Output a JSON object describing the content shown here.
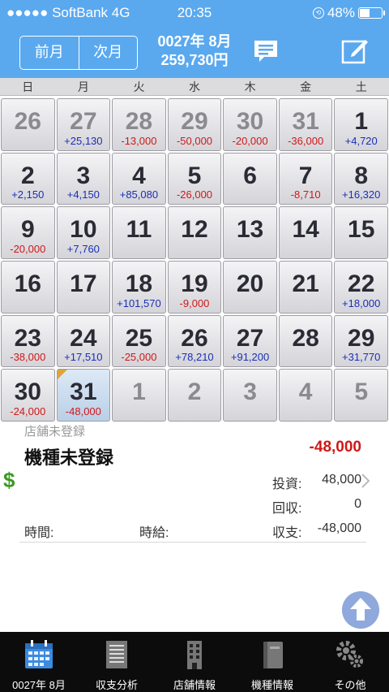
{
  "status": {
    "carrier": "●●●●● SoftBank  4G",
    "time": "20:35",
    "battery": "48%",
    "battery_level": 0.48
  },
  "header": {
    "prev_label": "前月",
    "next_label": "次月",
    "title": "0027年 8月",
    "subtitle": "259,730円"
  },
  "weekdays": [
    "日",
    "月",
    "火",
    "水",
    "木",
    "金",
    "土"
  ],
  "calendar": [
    [
      {
        "d": "26",
        "a": "",
        "g": true
      },
      {
        "d": "27",
        "a": "+25,130",
        "g": true
      },
      {
        "d": "28",
        "a": "-13,000",
        "g": true
      },
      {
        "d": "29",
        "a": "-50,000",
        "g": true
      },
      {
        "d": "30",
        "a": "-20,000",
        "g": true
      },
      {
        "d": "31",
        "a": "-36,000",
        "g": true
      },
      {
        "d": "1",
        "a": "+4,720",
        "g": false
      }
    ],
    [
      {
        "d": "2",
        "a": "+2,150",
        "g": false
      },
      {
        "d": "3",
        "a": "+4,150",
        "g": false
      },
      {
        "d": "4",
        "a": "+85,080",
        "g": false
      },
      {
        "d": "5",
        "a": "-26,000",
        "g": false
      },
      {
        "d": "6",
        "a": "",
        "g": false
      },
      {
        "d": "7",
        "a": "-8,710",
        "g": false
      },
      {
        "d": "8",
        "a": "+16,320",
        "g": false
      }
    ],
    [
      {
        "d": "9",
        "a": "-20,000",
        "g": false
      },
      {
        "d": "10",
        "a": "+7,760",
        "g": false
      },
      {
        "d": "11",
        "a": "",
        "g": false
      },
      {
        "d": "12",
        "a": "",
        "g": false
      },
      {
        "d": "13",
        "a": "",
        "g": false
      },
      {
        "d": "14",
        "a": "",
        "g": false
      },
      {
        "d": "15",
        "a": "",
        "g": false
      }
    ],
    [
      {
        "d": "16",
        "a": "",
        "g": false
      },
      {
        "d": "17",
        "a": "",
        "g": false
      },
      {
        "d": "18",
        "a": "+101,570",
        "g": false
      },
      {
        "d": "19",
        "a": "-9,000",
        "g": false
      },
      {
        "d": "20",
        "a": "",
        "g": false
      },
      {
        "d": "21",
        "a": "",
        "g": false
      },
      {
        "d": "22",
        "a": "+18,000",
        "g": false
      }
    ],
    [
      {
        "d": "23",
        "a": "-38,000",
        "g": false
      },
      {
        "d": "24",
        "a": "+17,510",
        "g": false
      },
      {
        "d": "25",
        "a": "-25,000",
        "g": false
      },
      {
        "d": "26",
        "a": "+78,210",
        "g": false
      },
      {
        "d": "27",
        "a": "+91,200",
        "g": false
      },
      {
        "d": "28",
        "a": "",
        "g": false
      },
      {
        "d": "29",
        "a": "+31,770",
        "g": false
      }
    ],
    [
      {
        "d": "30",
        "a": "-24,000",
        "g": false
      },
      {
        "d": "31",
        "a": "-48,000",
        "g": false,
        "sel": true
      },
      {
        "d": "1",
        "a": "",
        "g": true
      },
      {
        "d": "2",
        "a": "",
        "g": true
      },
      {
        "d": "3",
        "a": "",
        "g": true
      },
      {
        "d": "4",
        "a": "",
        "g": true
      },
      {
        "d": "5",
        "a": "",
        "g": true
      }
    ]
  ],
  "detail": {
    "shop": "店舗未登録",
    "machine": "機種未登録",
    "total": "-48,000",
    "invest_label": "投資:",
    "invest_value": "48,000",
    "recover_label": "回収:",
    "recover_value": "0",
    "balance_label": "収支:",
    "balance_value": "-48,000",
    "time_label": "時間:",
    "hourly_label": "時給:"
  },
  "tabs": [
    {
      "label": "0027年 8月",
      "icon": "calendar-icon"
    },
    {
      "label": "収支分析",
      "icon": "document-icon"
    },
    {
      "label": "店舗情報",
      "icon": "building-icon"
    },
    {
      "label": "機種情報",
      "icon": "book-icon"
    },
    {
      "label": "その他",
      "icon": "gears-icon"
    }
  ],
  "colors": {
    "header": "#5aa9ef",
    "positive": "#1b2fb5",
    "negative": "#d01818",
    "tabbar": "#0c0c0c",
    "accent": "#3b8be0"
  }
}
